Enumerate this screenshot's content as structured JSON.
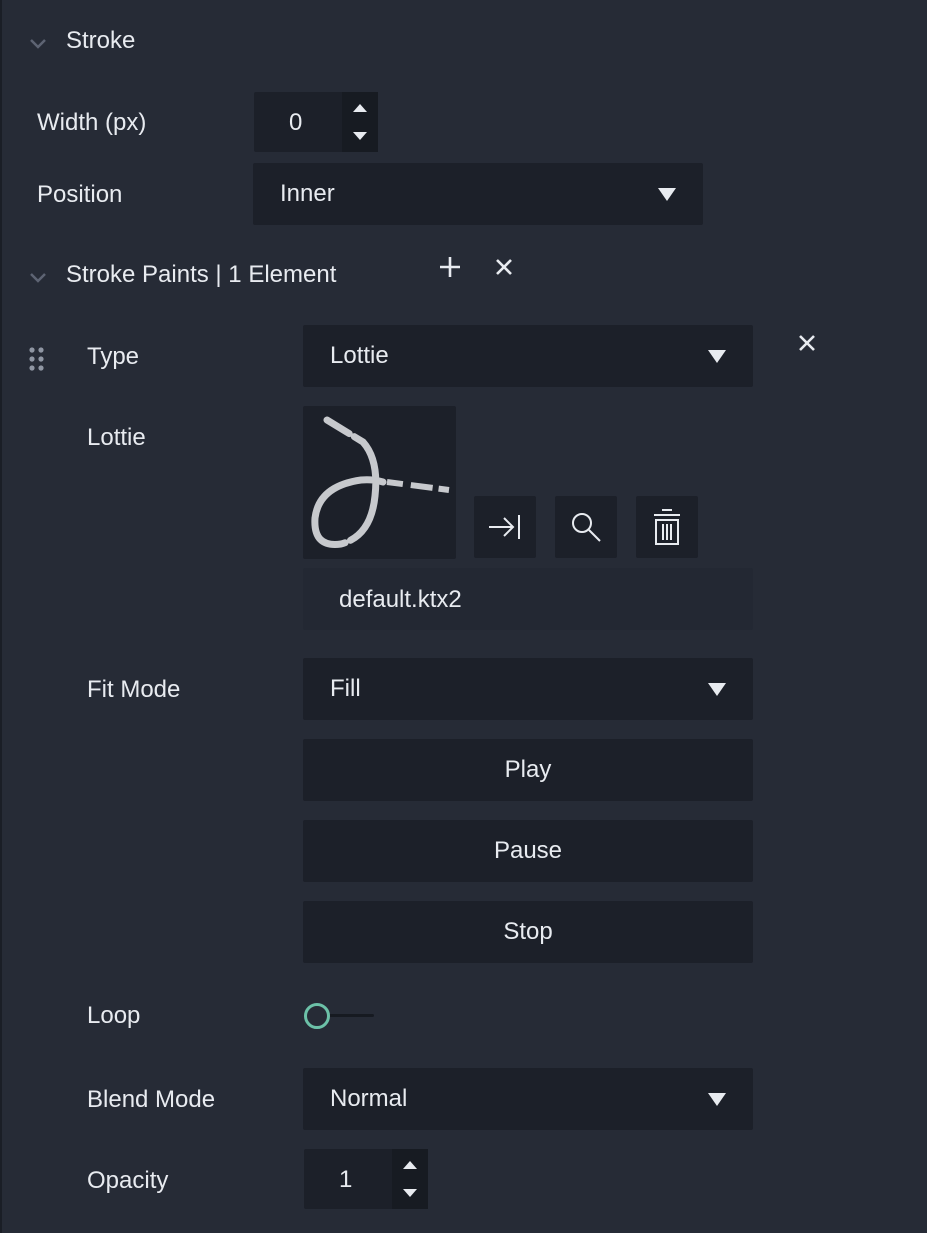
{
  "stroke": {
    "section_title": "Stroke",
    "width_label": "Width (px)",
    "width_value": "0",
    "position_label": "Position",
    "position_value": "Inner"
  },
  "stroke_paints": {
    "section_title": "Stroke Paints | 1 Element",
    "add_icon": "plus-icon",
    "remove_icon": "close-icon",
    "element": {
      "type_label": "Type",
      "type_value": "Lottie",
      "lottie_label": "Lottie",
      "file_name": "default.ktx2",
      "asset_buttons": [
        "navigate-to-icon",
        "search-icon",
        "trash-icon"
      ],
      "fit_mode_label": "Fit Mode",
      "fit_mode_value": "Fill",
      "play_label": "Play",
      "pause_label": "Pause",
      "stop_label": "Stop",
      "loop_label": "Loop",
      "loop_on": false,
      "blend_mode_label": "Blend Mode",
      "blend_mode_value": "Normal",
      "opacity_label": "Opacity",
      "opacity_value": "1"
    }
  },
  "colors": {
    "panel_bg": "#262b36",
    "control_bg": "#1c2029",
    "text": "#e8ebf0",
    "toggle_accent": "#6cc1a8"
  }
}
